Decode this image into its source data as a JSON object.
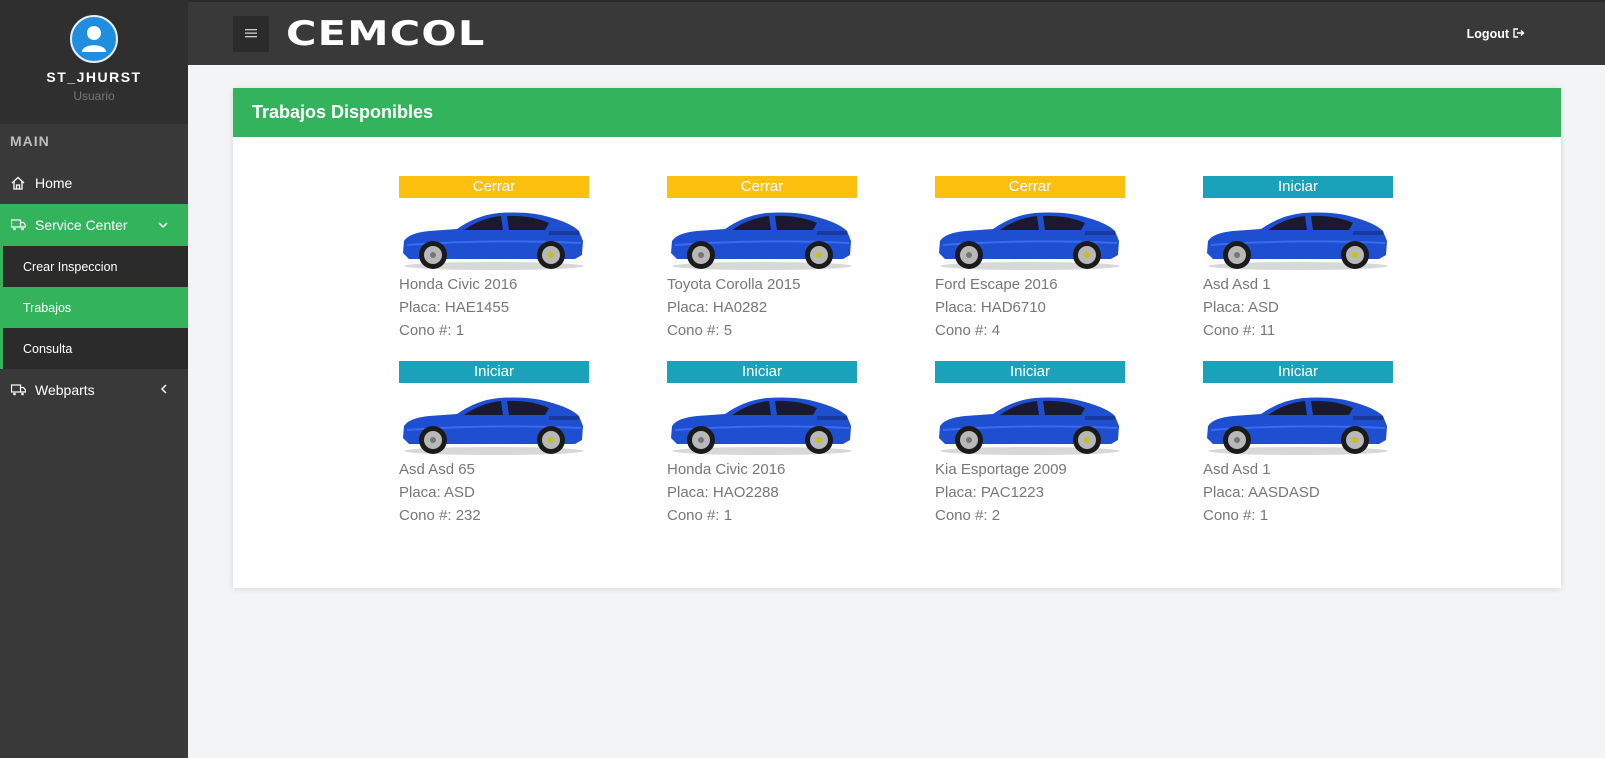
{
  "sidebar": {
    "username": "ST_JHURST",
    "role": "Usuario",
    "section_title": "MAIN",
    "nav": {
      "home": "Home",
      "service_center": "Service Center",
      "webparts": "Webparts"
    },
    "sub_items": [
      "Crear Inspeccion",
      "Trabajos",
      "Consulta"
    ]
  },
  "header": {
    "brand": "CEMCOL",
    "logout": "Logout"
  },
  "panel": {
    "title": "Trabajos Disponibles"
  },
  "jobs": [
    {
      "action": "Cerrar",
      "vehicle": "Honda Civic 2016",
      "placa": "Placa: HAE1455",
      "cono": "Cono #: 1"
    },
    {
      "action": "Cerrar",
      "vehicle": "Toyota Corolla 2015",
      "placa": "Placa: HA0282",
      "cono": "Cono #: 5"
    },
    {
      "action": "Cerrar",
      "vehicle": "Ford Escape 2016",
      "placa": "Placa: HAD6710",
      "cono": "Cono #: 4"
    },
    {
      "action": "Iniciar",
      "vehicle": "Asd Asd 1",
      "placa": "Placa: ASD",
      "cono": "Cono #: 11"
    },
    {
      "action": "Iniciar",
      "vehicle": "Asd Asd 65",
      "placa": "Placa: ASD",
      "cono": "Cono #: 232"
    },
    {
      "action": "Iniciar",
      "vehicle": "Honda Civic 2016",
      "placa": "Placa: HAO2288",
      "cono": "Cono #: 1"
    },
    {
      "action": "Iniciar",
      "vehicle": "Kia Esportage 2009",
      "placa": "Placa: PAC1223",
      "cono": "Cono #: 2"
    },
    {
      "action": "Iniciar",
      "vehicle": "Asd Asd 1",
      "placa": "Placa: AASDASD",
      "cono": "Cono #: 1"
    }
  ],
  "colors": {
    "accent_green": "#33b35b",
    "cerrar_yellow": "#fdc00f",
    "iniciar_teal": "#19a2ba",
    "sidebar_dark": "#393939"
  },
  "icons": {
    "avatar": "user-icon",
    "home": "home-icon",
    "service_center": "truck-icon",
    "webparts": "truck-icon",
    "menu": "hamburger-icon",
    "logout": "logout-icon"
  }
}
